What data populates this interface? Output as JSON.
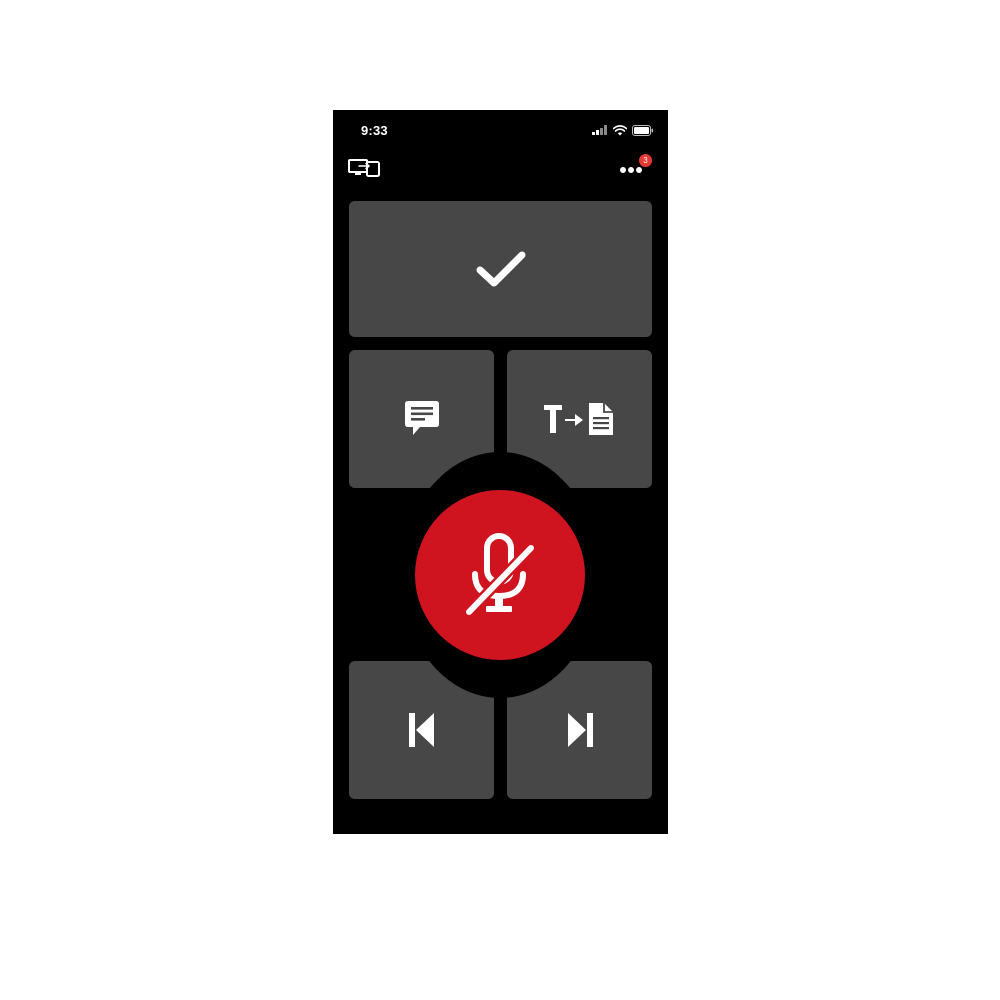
{
  "status_bar": {
    "time": "9:33",
    "signal_icon": "cellular-signal-icon",
    "wifi_icon": "wifi-icon",
    "battery_icon": "battery-icon"
  },
  "top_bar": {
    "cast_icon": "screen-cast-icon",
    "more_icon": "more-dots-icon",
    "notification_count": "3"
  },
  "controls": {
    "confirm_icon": "checkmark-icon",
    "comment_icon": "comment-icon",
    "text_to_document_icon": "text-to-document-icon",
    "mic_icon": "microphone-muted-icon",
    "previous_icon": "skip-previous-icon",
    "next_icon": "skip-next-icon"
  },
  "colors": {
    "background": "#000000",
    "tile": "#474747",
    "mic_button": "#d0141f",
    "badge": "#e53935",
    "icon": "#ffffff"
  }
}
